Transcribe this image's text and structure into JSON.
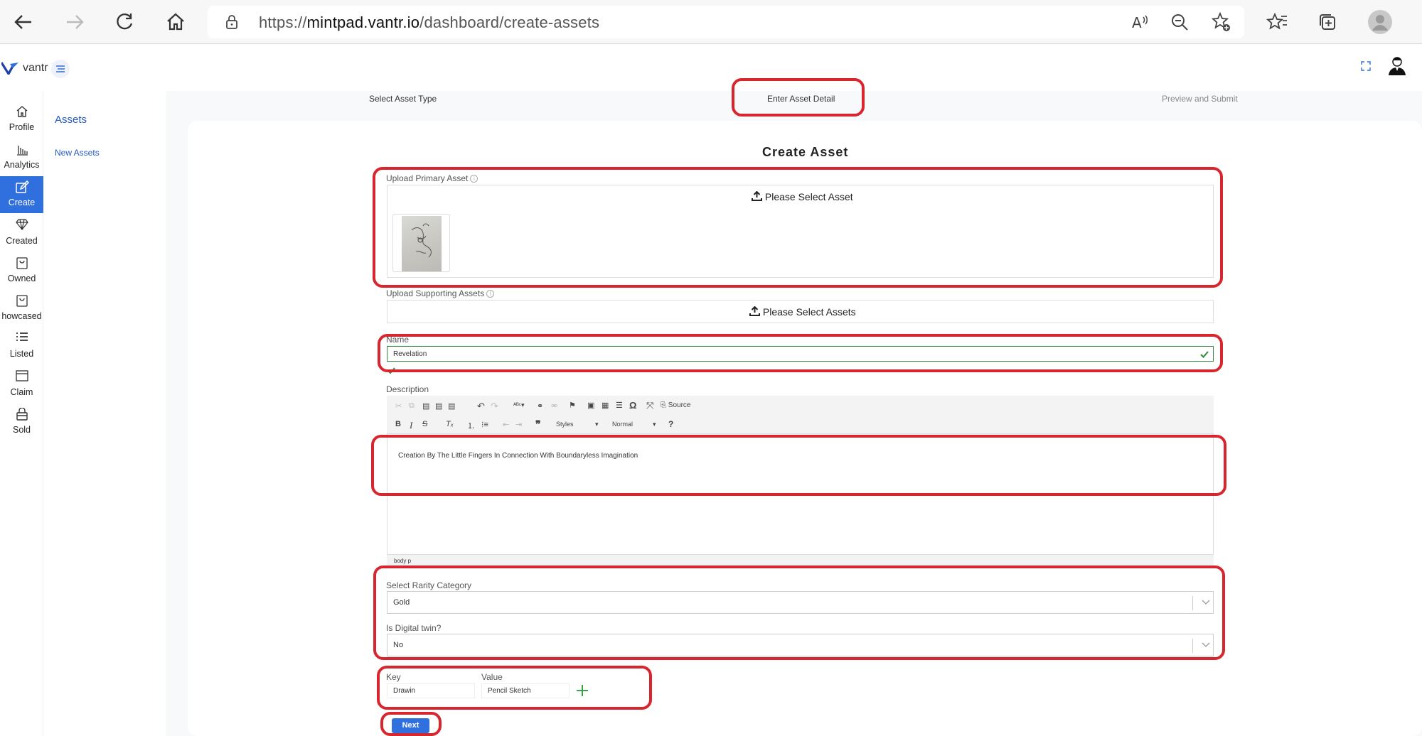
{
  "browser": {
    "url_prefix": "https://",
    "url_domain": "mintpad.vantr.io",
    "url_path": "/dashboard/create-assets",
    "icons": [
      "back-icon",
      "forward-icon",
      "refresh-icon",
      "home-icon",
      "lock-icon",
      "read-aloud-icon",
      "zoom-out-icon",
      "add-favorite-icon",
      "favorites-icon",
      "collections-icon",
      "profile-icon"
    ]
  },
  "header": {
    "brand": "vantr"
  },
  "sidebar": {
    "items": [
      {
        "label": "Profile",
        "icon": "home-icon"
      },
      {
        "label": "Analytics",
        "icon": "bar-chart-icon"
      },
      {
        "label": "Create",
        "icon": "edit-icon",
        "active": true
      },
      {
        "label": "Created",
        "icon": "diamond-icon"
      },
      {
        "label": "Owned",
        "icon": "bag-icon"
      },
      {
        "label": "howcased",
        "icon": "bag-icon"
      },
      {
        "label": "Listed",
        "icon": "list-icon"
      },
      {
        "label": "Claim",
        "icon": "window-icon"
      },
      {
        "label": "Sold",
        "icon": "lock-bag-icon"
      }
    ]
  },
  "subsidebar": {
    "title": "Assets",
    "item": "New Assets"
  },
  "steps": [
    "Select Asset Type",
    "Enter Asset Detail",
    "Preview and Submit"
  ],
  "form": {
    "title": "Create Asset",
    "primary_label": "Upload Primary Asset",
    "primary_button": "Please Select Asset",
    "supporting_label": "Upload Supporting Assets",
    "supporting_button": "Please Select Assets",
    "name_label": "Name",
    "name_value": "Revelation",
    "description_label": "Description",
    "description_value": "Creation By The Little Fingers In Connection With Boundaryless Imagination",
    "editor_source": "Source",
    "editor_styles": "Styles",
    "editor_format": "Normal",
    "editor_help": "?",
    "editor_path": "body  p",
    "rarity_label": "Select Rarity Category",
    "rarity_value": "Gold",
    "twin_label": "Is Digital twin?",
    "twin_value": "No",
    "key_label": "Key",
    "value_label": "Value",
    "key_value": "Drawin",
    "value_value": "Pencil Sketch",
    "next": "Next"
  },
  "colors": {
    "accent": "#2f6fde",
    "highlight": "#d8262f",
    "valid": "#2e8b3a"
  }
}
